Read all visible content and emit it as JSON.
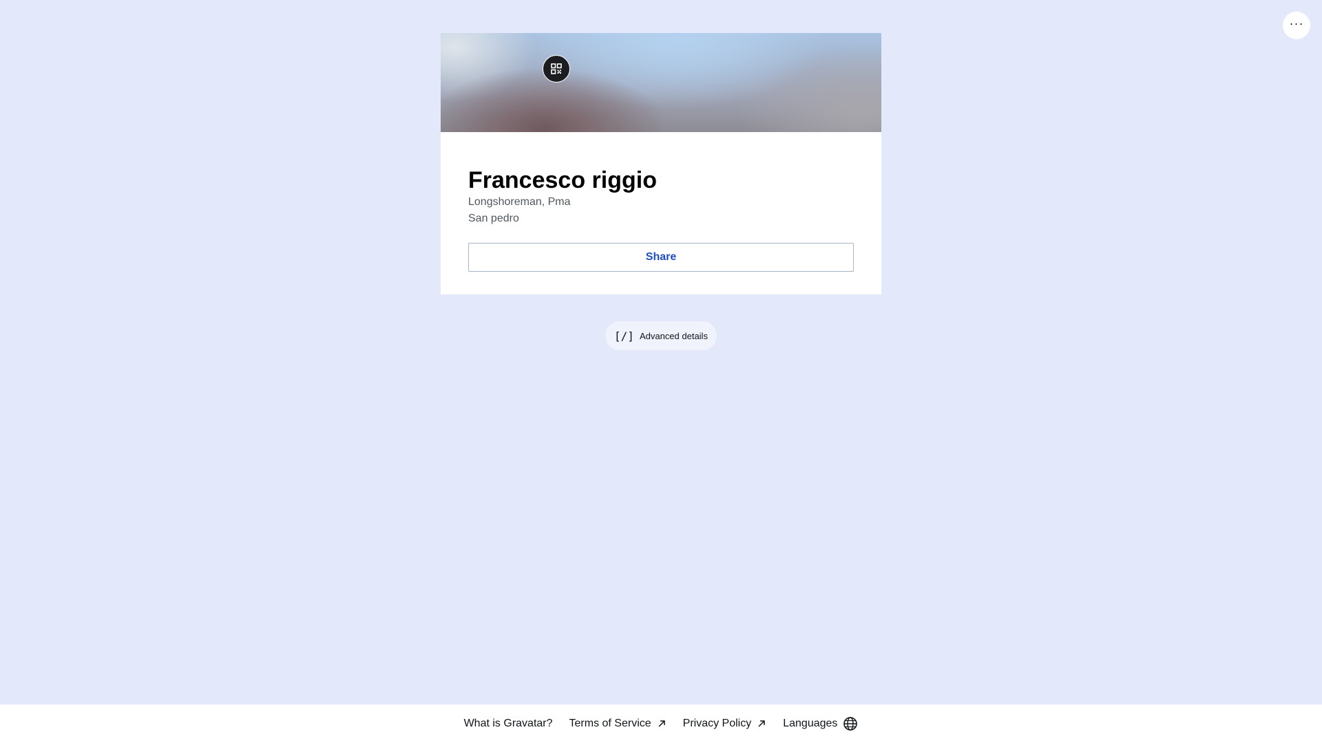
{
  "top_actions": {
    "more_label": "···",
    "more_icon": "ellipsis-icon"
  },
  "card": {
    "qr_icon": "qr-code-icon",
    "name": "Francesco riggio",
    "job": "Longshoreman, Pma",
    "location": "San pedro",
    "share_label": "Share"
  },
  "advanced": {
    "icon_glyph": "[/]",
    "icon": "code-icon",
    "label": "Advanced details"
  },
  "footer": {
    "links": [
      {
        "label": "What is Gravatar?",
        "icon": ""
      },
      {
        "label": "Terms of Service",
        "icon": "external-arrow-icon"
      },
      {
        "label": "Privacy Policy",
        "icon": "external-arrow-icon"
      },
      {
        "label": "Languages",
        "icon": "globe-icon"
      }
    ]
  },
  "colors": {
    "background": "#e3e9fa",
    "accent": "#1d4fc4",
    "card": "#ffffff"
  }
}
